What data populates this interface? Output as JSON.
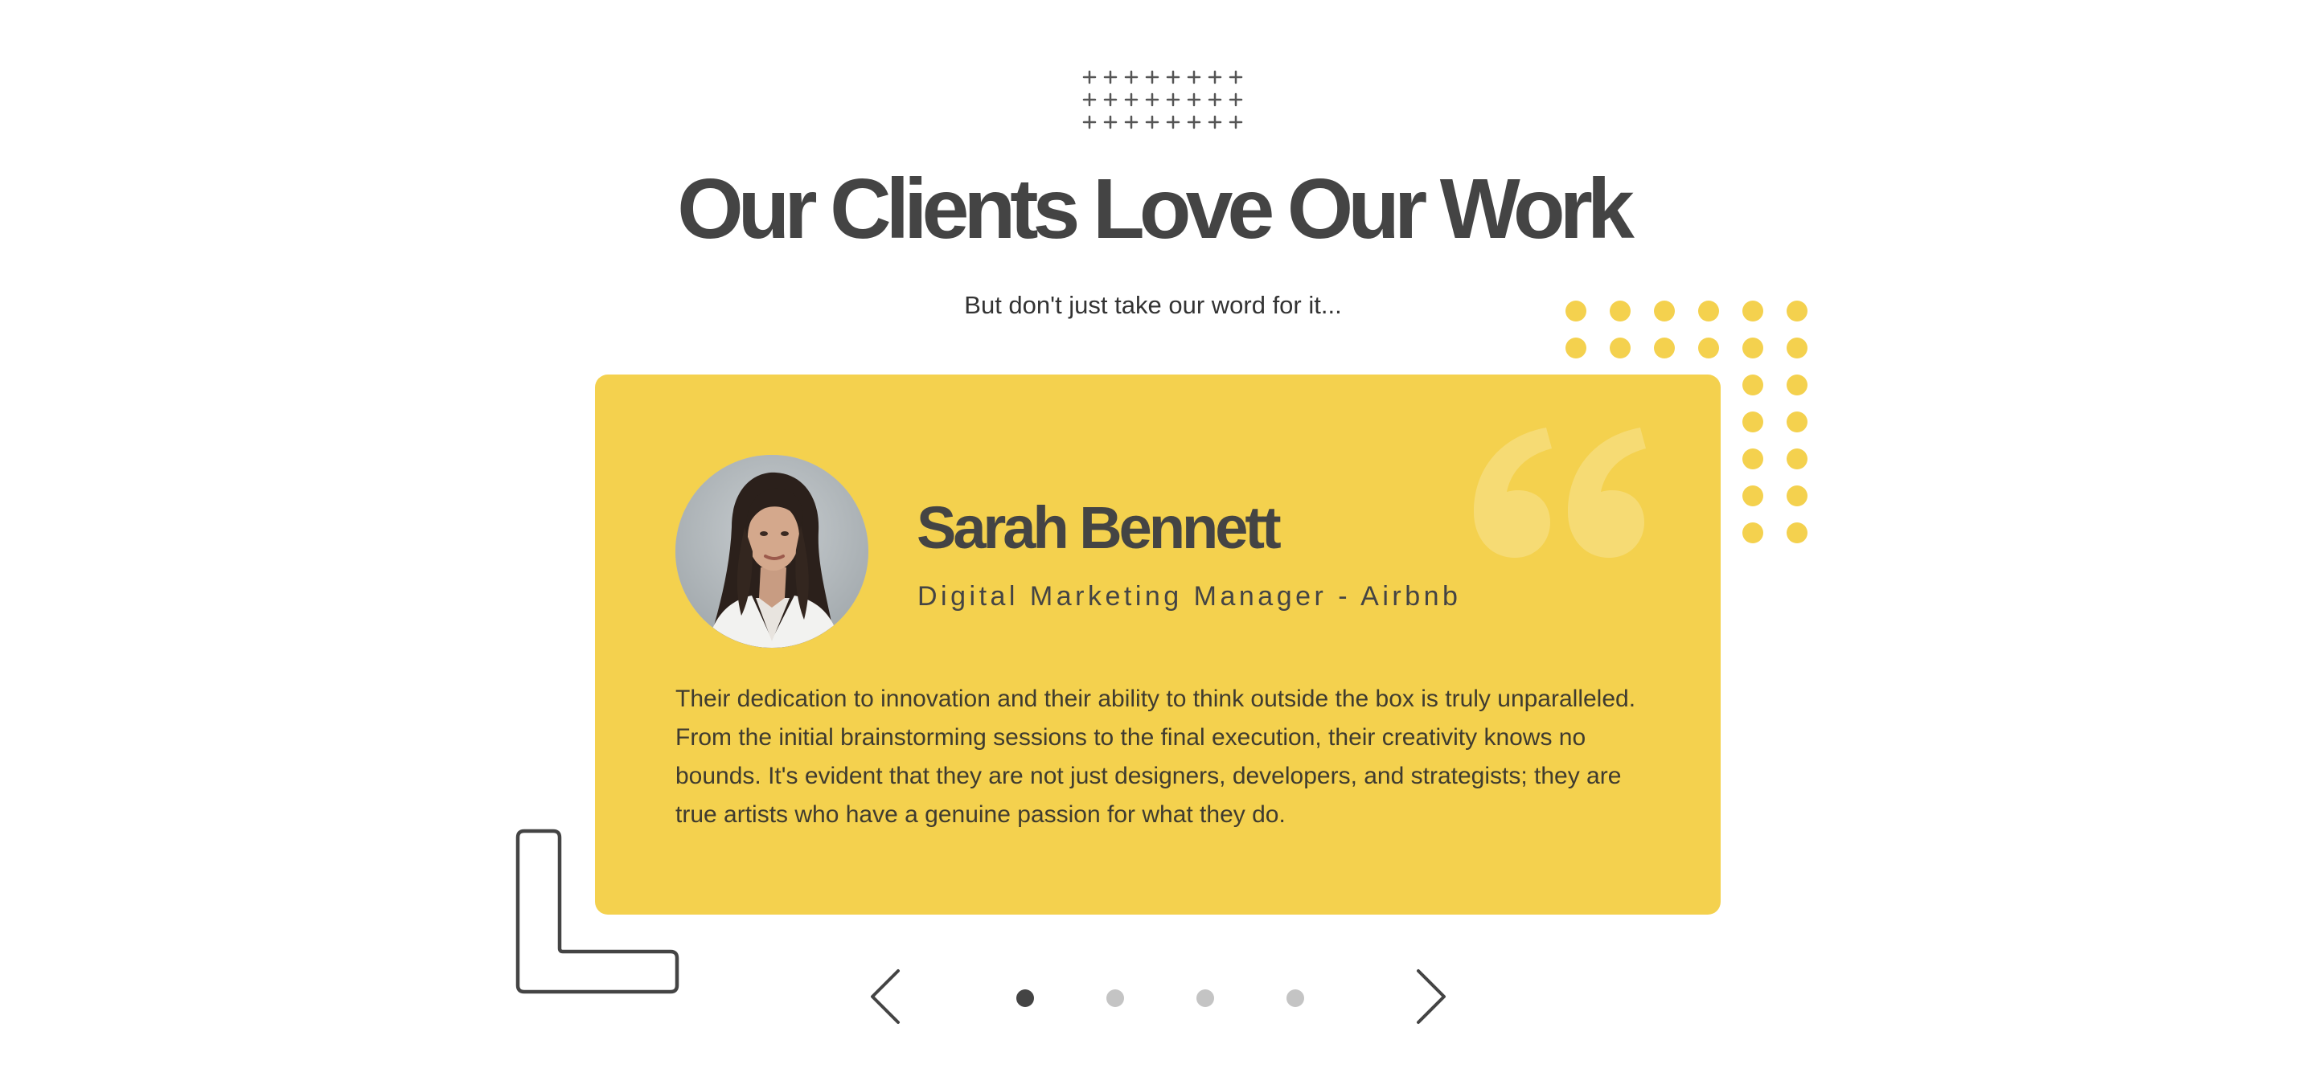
{
  "header": {
    "title": "Our Clients Love Our Work",
    "subtitle": "But don't just take our word for it..."
  },
  "testimonial": {
    "name": "Sarah Bennett",
    "role": "Digital Marketing Manager - Airbnb",
    "quote": "Their dedication to innovation and their ability to think outside the box is truly unparalleled. From the initial brainstorming sessions to the final execution, their creativity knows no bounds. It's evident that they are not just designers, developers, and strategists; they are true artists who have a genuine passion for what they do.",
    "avatar_alt": "Sarah Bennett"
  },
  "carousel": {
    "slide_count": 4,
    "active_index": 0
  },
  "colors": {
    "card": "#f4d14e",
    "accent_dots": "#f4d14e",
    "text_dark": "#444444",
    "dot_inactive": "#c4c4c4",
    "dot_active": "#444444"
  },
  "icons": {
    "prev": "chevron-left-icon",
    "next": "chevron-right-icon",
    "quote": "quote-mark-icon"
  }
}
